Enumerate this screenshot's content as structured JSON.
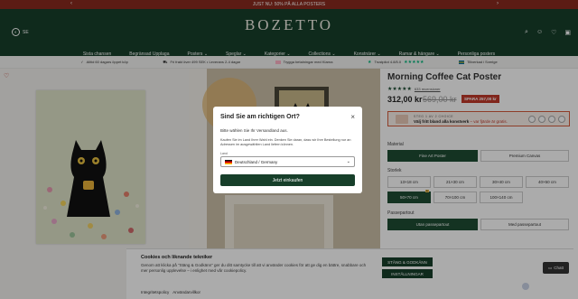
{
  "announcement": {
    "text": "JUST NU: 50% PÅ ALLA POSTERS"
  },
  "header": {
    "brand": "BOZETTO",
    "lang": "SE",
    "nav": [
      "Sista chansen",
      "Begränsad Upplaga",
      "Posters",
      "Speglar",
      "Kategorier",
      "Collections",
      "Konstnärer",
      "Ramar & hängare",
      "Personliga posters"
    ]
  },
  "usp": {
    "items": [
      "Alltid 60 dagars öppet köp",
      "Fri frakt över 499 SEK • Leverans 2-4 dagar",
      "Trygga betalningar med Klarna",
      "Trustpilot  4.8/5.0",
      "Tillverkad i Sverige"
    ]
  },
  "product": {
    "title": "Morning Coffee Cat Poster",
    "stars": "★★★★★",
    "reviews": "633 recensioner",
    "price": "312,00 kr",
    "old_price": "569,00 kr",
    "save": "SPARA 257,00 kr",
    "promo_step": "STEG 1 AV 2 CHOICE",
    "promo_text_bold": "Välj fritt bland alla konstverk",
    "promo_text_link": "– var fjärde är gratis.",
    "material_label": "Material",
    "materials": [
      "Fine Art Poster",
      "Premium Canvas"
    ],
    "sizes_label": "Storlek",
    "sizes": [
      "13×18 cm",
      "21×30 cm",
      "30×40 cm",
      "40×50 cm",
      "50×70 cm",
      "70×100 cm",
      "100×140 cm"
    ],
    "passepartout_label": "Passepartout",
    "passepartouts": [
      "Utan passepartout",
      "Med passepartout"
    ]
  },
  "cookie": {
    "title": "Cookies och liknande tekniker",
    "body": "Genom att klicka på \"Stäng & Godkänn\" ger du ditt samtycke till att vi använder cookies för att ge dig en bättre, snabbare och mer personlig upplevelse – i enlighet med vår cookiepolicy.",
    "accept": "STÄNG & GODKÄNN",
    "settings": "INSTÄLLNINGAR",
    "link1": "Integritetspolicy",
    "link2": "Användarvillkor"
  },
  "chat": {
    "label": "Chatt"
  },
  "modal": {
    "title": "Sind Sie am richtigen Ort?",
    "sub": "Bitte wählen Sie Ihr Versandland aus.",
    "body": "Kaufen Sie im Land Ihrer Wahl ein. Denken Sie daran, dass wir Ihre Bestellung nur an Adressen im ausgewählten Land liefern können.",
    "label": "Land",
    "selected": "Deutschland / Germany",
    "button": "Jetzt einkaufen"
  },
  "colors": {
    "brand_green": "#173f2a",
    "sale_red": "#c0392b",
    "announce": "#8a2b1e"
  }
}
